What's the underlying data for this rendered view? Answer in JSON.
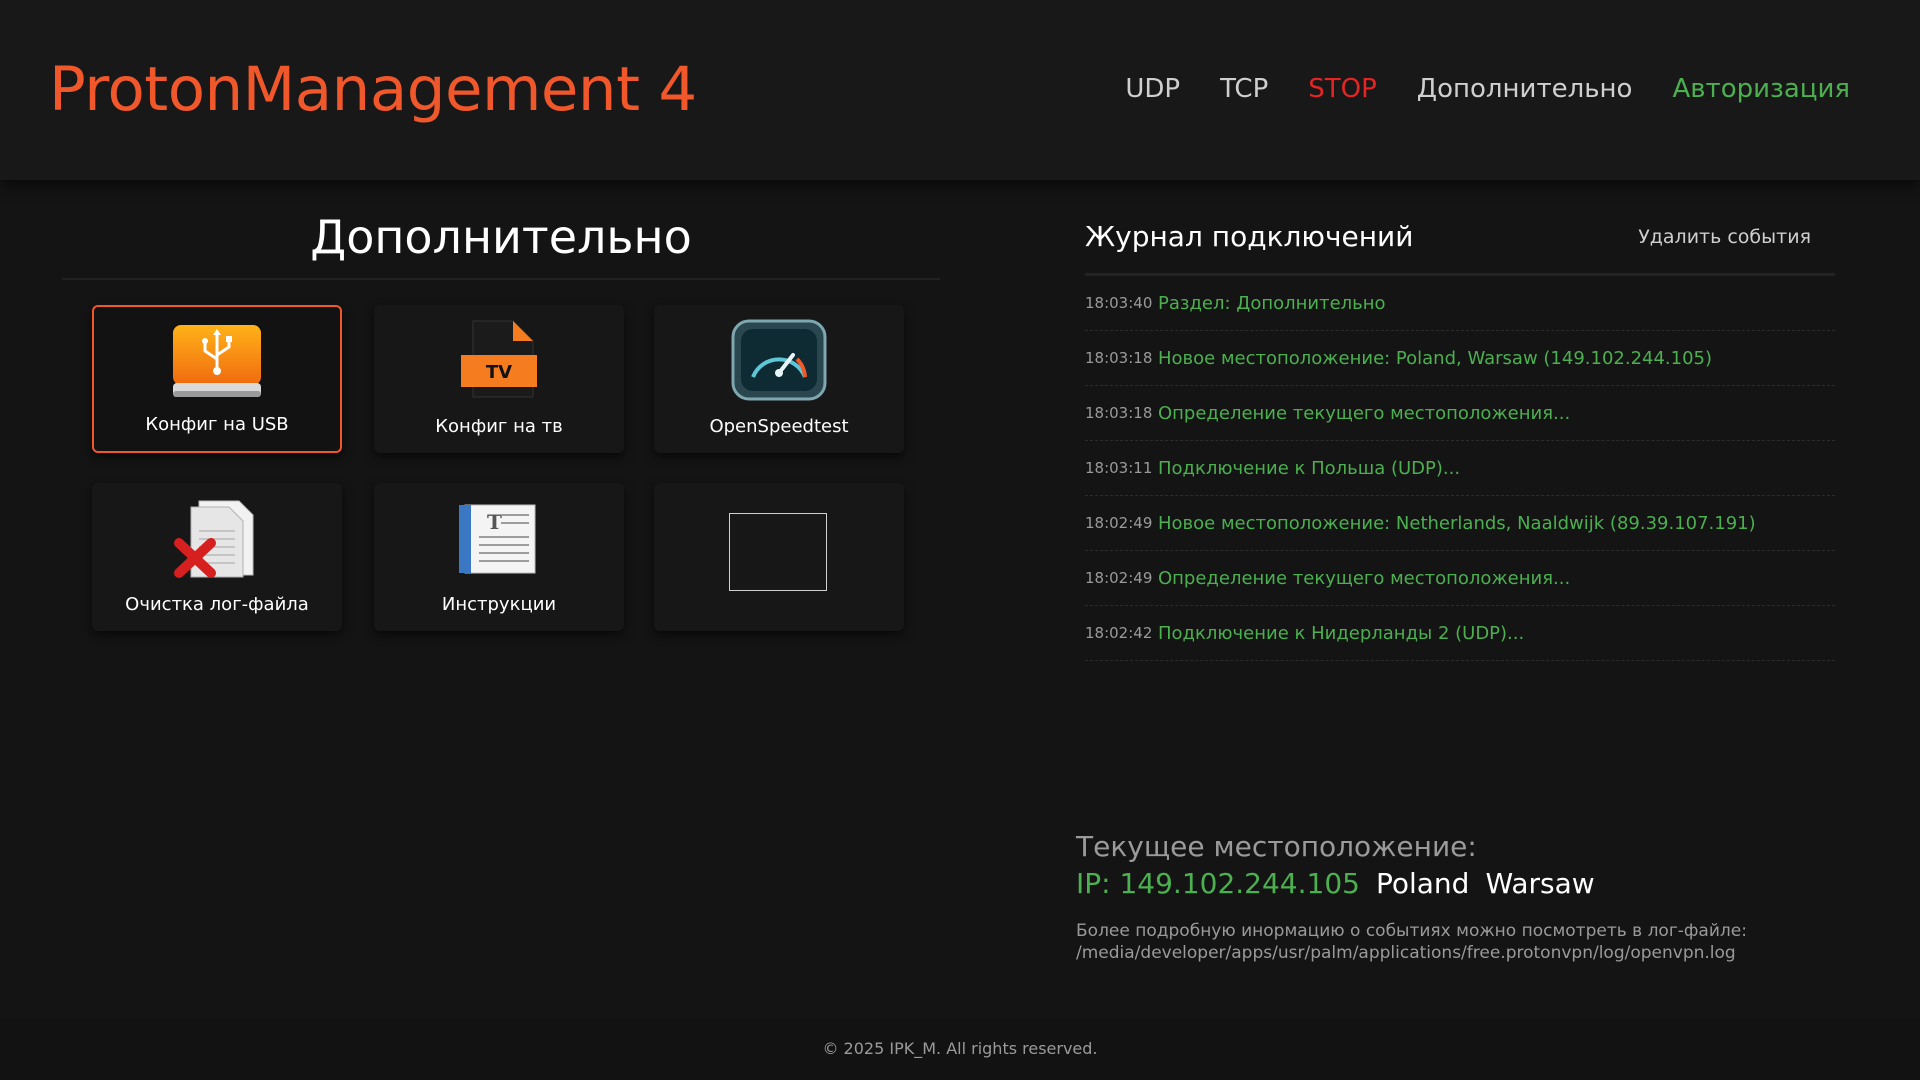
{
  "app": {
    "title": "ProtonManagement 4"
  },
  "nav": {
    "items": [
      {
        "label": "UDP",
        "color": "#cfcfcf"
      },
      {
        "label": "TCP",
        "color": "#cfcfcf"
      },
      {
        "label": "STOP",
        "color": "#e52424"
      },
      {
        "label": "Дополнительно",
        "color": "#cfcfcf"
      },
      {
        "label": "Авторизация",
        "color": "#4caf50"
      }
    ]
  },
  "section": {
    "title": "Дополнительно"
  },
  "tiles": [
    {
      "label": "Конфиг на USB",
      "icon": "usb-drive-icon",
      "selected": true
    },
    {
      "label": "Конфиг на тв",
      "icon": "tv-file-icon",
      "selected": false
    },
    {
      "label": "OpenSpeedtest",
      "icon": "speedometer-icon",
      "selected": false
    },
    {
      "label": "Очистка лог-файла",
      "icon": "delete-document-icon",
      "selected": false
    },
    {
      "label": "Инструкции",
      "icon": "document-icon",
      "selected": false
    },
    {
      "label": "",
      "icon": "empty-placeholder",
      "selected": false
    }
  ],
  "log": {
    "title": "Журнал подключений",
    "clear_label": "Удалить события",
    "entries": [
      {
        "time": "18:03:40",
        "message": "Раздел: Дополнительно"
      },
      {
        "time": "18:03:18",
        "message": "Новое местоположение: Poland, Warsaw (149.102.244.105)"
      },
      {
        "time": "18:03:18",
        "message": "Определение текущего местоположения..."
      },
      {
        "time": "18:03:11",
        "message": "Подключение к Польша (UDP)..."
      },
      {
        "time": "18:02:49",
        "message": "Новое местоположение: Netherlands, Naaldwijk (89.39.107.191)"
      },
      {
        "time": "18:02:49",
        "message": "Определение текущего местоположения..."
      },
      {
        "time": "18:02:42",
        "message": "Подключение к Нидерланды 2 (UDP)..."
      }
    ]
  },
  "location": {
    "title": "Текущее местоположение:",
    "ip": "IP: 149.102.244.105",
    "country": "Poland",
    "city": "Warsaw",
    "note_line1": "Более подробную инормацию о событиях можно посмотреть в лог-файле:",
    "note_line2": "/media/developer/apps/usr/palm/applications/free.protonvpn/log/openvpn.log"
  },
  "footer": {
    "text": "© 2025 IPK_M. All rights reserved."
  },
  "colors": {
    "accent": "#f0572a",
    "success": "#4caf50",
    "danger": "#e52424"
  }
}
